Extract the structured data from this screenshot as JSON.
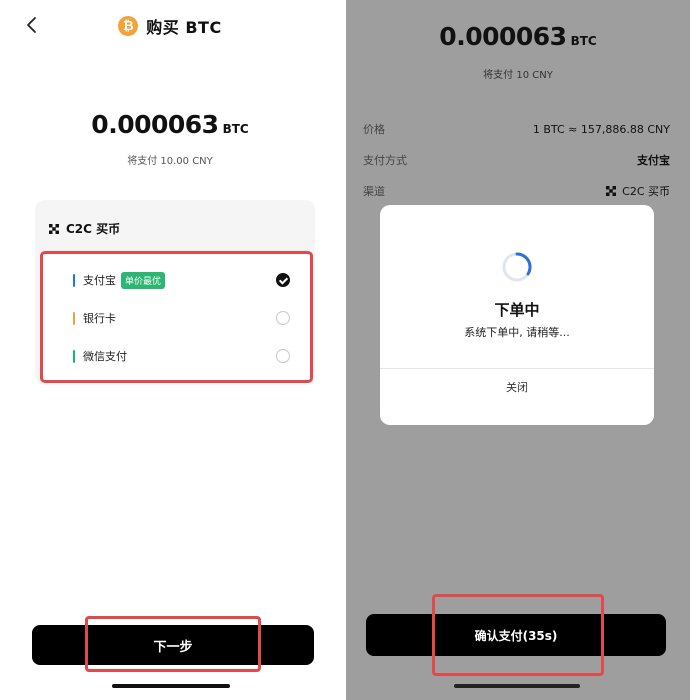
{
  "left": {
    "header": {
      "coin_symbol": "₿",
      "title": "购买 BTC",
      "back_icon": "chevron-left-icon"
    },
    "amount": {
      "value": "0.000063",
      "unit": "BTC"
    },
    "will_pay": "将支付 10.00 CNY",
    "c2c": {
      "icon": "c2c-icon",
      "label": "C2C 买币",
      "methods": [
        {
          "label": "支付宝",
          "badge": "单价最优",
          "bar_color": "#1677ff",
          "selected": true
        },
        {
          "label": "银行卡",
          "bar_color": "#e6a23c",
          "selected": false
        },
        {
          "label": "微信支付",
          "bar_color": "#07c160",
          "selected": false
        }
      ]
    },
    "next_label": "下一步"
  },
  "right": {
    "amount": {
      "value": "0.000063",
      "unit": "BTC"
    },
    "will_pay": "将支付 10 CNY",
    "rows": [
      {
        "key": "价格",
        "value": "1 BTC ≈ 157,886.88 CNY"
      },
      {
        "key": "支付方式",
        "value": "支付宝"
      },
      {
        "key": "渠道",
        "value": "C2C 买币"
      }
    ],
    "dialog": {
      "title": "下单中",
      "message": "系统下单中, 请稍等...",
      "close_label": "关闭",
      "spinner_icon": "loading-spinner-icon"
    },
    "confirm_label": "确认支付(35s)"
  },
  "colors": {
    "highlight": "#e04a4a",
    "badge": "#2bb673",
    "coin": "#f3a33b",
    "overlay": "#9e9e9e"
  }
}
